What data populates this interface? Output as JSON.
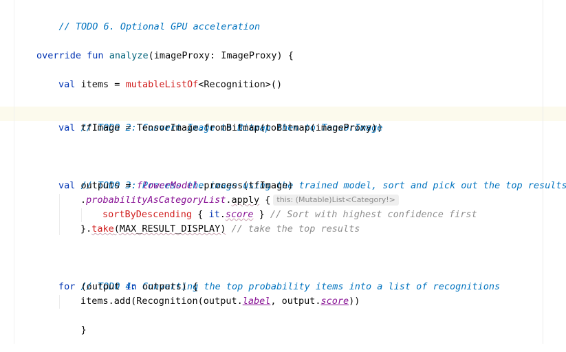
{
  "editor": {
    "lines": {
      "todo6": "// TODO 6. Optional GPU acceleration",
      "override_kw": "override",
      "fun_kw": "fun",
      "fn_name": "analyze",
      "fn_sig": "(imageProxy: ImageProxy) {",
      "val1_kw": "val",
      "items_decl": "items = ",
      "mutable_fn": "mutableListOf",
      "items_rest": "<Recognition>()",
      "todo2": "// TODO 2: Convert Image to Bitmap then to TensorImage",
      "val2_kw": "val",
      "tf_decl": "tfImage = TensorImage.fromBitmap(toBitmap(imageProxy))",
      "todo3": "// TODO 3: Process the image using the trained model, sort and pick out the top results",
      "val3_kw": "val",
      "outputs_decl": "outputs = ",
      "flower_model": "flowerModel",
      "process_call": ".process(tfImage)",
      "dot1": ".",
      "prob_list": "probabilityAsCategoryList",
      "apply_dot": ".",
      "apply_fn": "apply",
      "apply_brace": " {",
      "apply_hint": "this: (Mutable)List<Category!>",
      "sort_fn": "sortByDescending",
      "sort_open": " { ",
      "it_kw": "it",
      "sort_dot": ".",
      "score_prop": "score",
      "sort_close": " } ",
      "sort_comment": "// Sort with highest confidence first",
      "take_brace": "}.",
      "take_fn": "take",
      "take_args": "(MAX_RESULT_DISPLAY)",
      "take_comment": " // take the top results",
      "todo4": "// TODO 4: Converting the top probability items into a list of recognitions",
      "for_kw": "for",
      "for_open": " (output ",
      "in_kw": "in",
      "for_rest": " outputs) {",
      "add_start": "items.add(Recognition(output.",
      "label_prop": "label",
      "add_mid": ", output.",
      "score2_prop": "score",
      "add_end": "))",
      "close_brace": "}"
    }
  }
}
